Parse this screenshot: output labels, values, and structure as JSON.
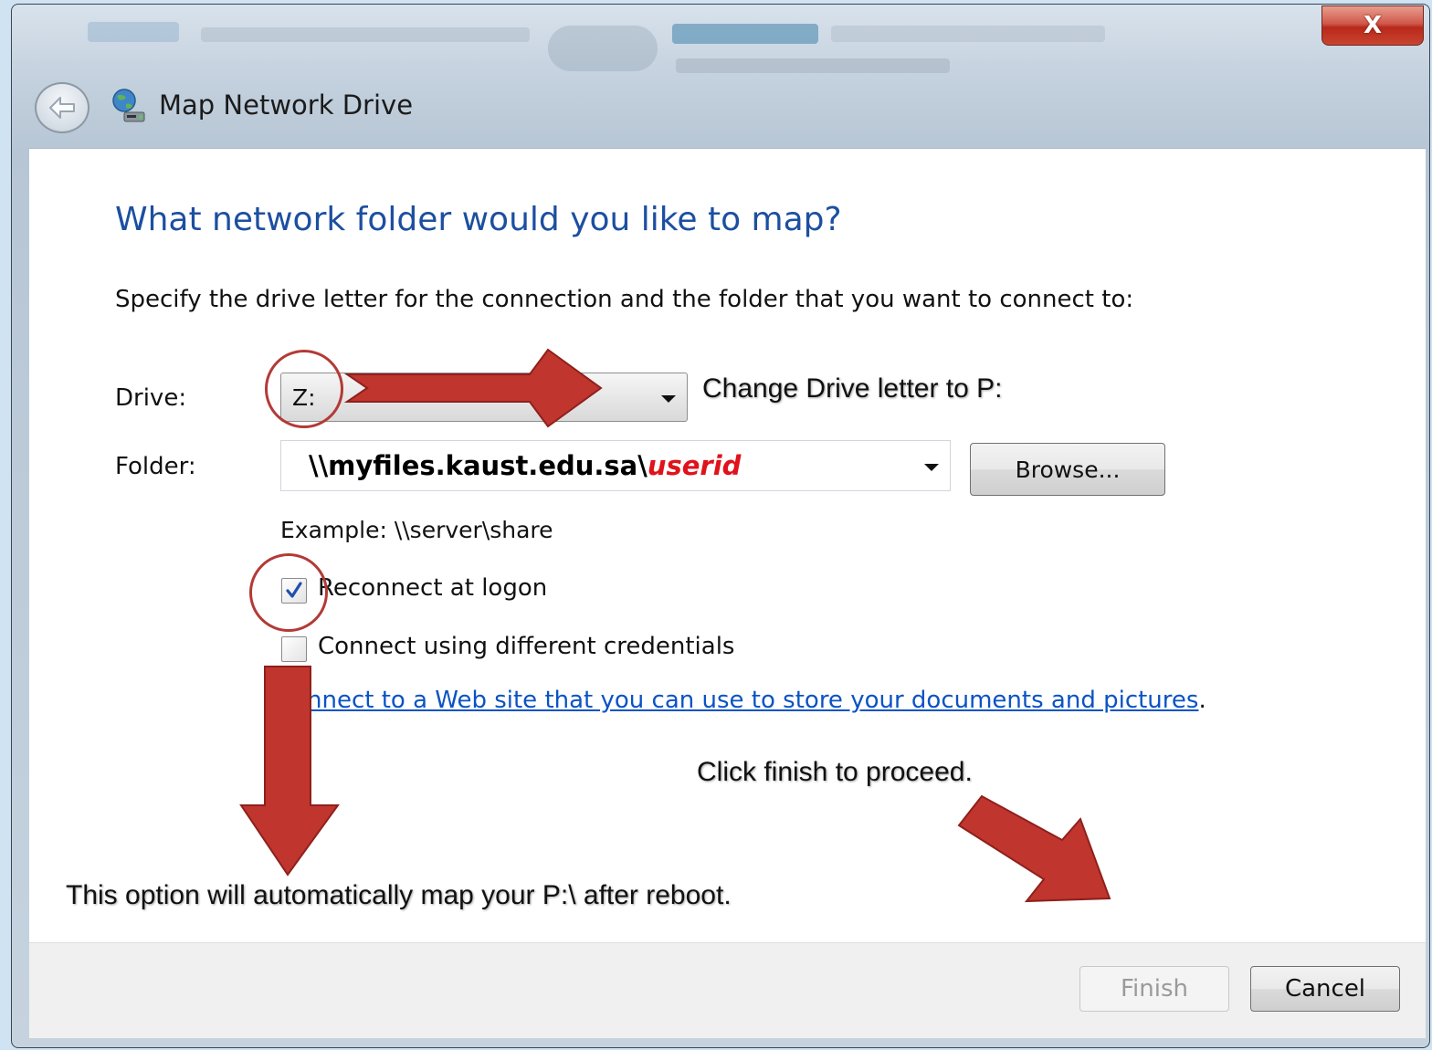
{
  "window": {
    "title": "Map Network Drive",
    "close_symbol": "X",
    "icons": {
      "back": "back-arrow-icon",
      "title": "network-drive-icon",
      "close": "close-icon"
    }
  },
  "wizard": {
    "heading": "What network folder would you like to map?",
    "instruction": "Specify the drive letter for the connection and the folder that you want to connect to:",
    "drive": {
      "label": "Drive:",
      "value": "Z:"
    },
    "folder": {
      "label": "Folder:",
      "value_prefix": "\\\\myfiles.kaust.edu.sa\\",
      "value_highlight": "userid",
      "highlight_color": "#e0121b",
      "browse_label": "Browse..."
    },
    "example": "Example: \\\\server\\share",
    "reconnect": {
      "label": "Reconnect at logon",
      "checked": true
    },
    "credentials": {
      "label": "Connect using different credentials",
      "checked": false
    },
    "web_link": {
      "text": "nnect to a Web site that you can use to store your documents and pictures",
      "suffix": "."
    }
  },
  "footer": {
    "finish_label": "Finish",
    "cancel_label": "Cancel",
    "finish_enabled": false
  },
  "annotations": {
    "drive_note": "Change Drive letter to P:",
    "finish_note": "Click finish to proceed.",
    "option_note": "This option will automatically map your P:\\  after reboot.",
    "arrow_color": "#c0352e",
    "ring_color": "#b33a36"
  },
  "colors": {
    "heading": "#1c4fa0",
    "link": "#0a53c4"
  }
}
